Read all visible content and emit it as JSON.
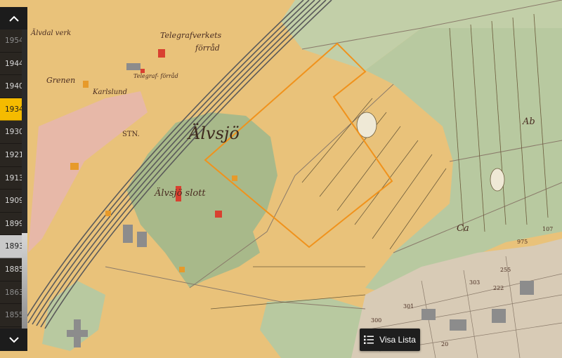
{
  "map": {
    "labels": {
      "area_main": "Älvsjö",
      "slott": "Älvsjö slott",
      "telegraf_top": "Telegrafverkets",
      "telegraf_bottom": "förråd",
      "telegraf_small": "Telegraf- förråd",
      "karlslund": "Karlslund",
      "alvdal": "Älvdal verk",
      "gren": "Grenen",
      "stn": "STN.",
      "ab": "Ab",
      "ca": "Ca",
      "numbers": [
        "303",
        "301",
        "300",
        "255",
        "107",
        "975",
        "222",
        "20"
      ]
    },
    "colors": {
      "field": "#e9c27a",
      "meadow": "#b8c9a0",
      "forest": "#a8b98a",
      "selection": "#f0921c",
      "rail": "#5a5a5a"
    }
  },
  "timeline": {
    "up_icon": "chevron-up-icon",
    "down_icon": "chevron-down-icon",
    "selected_year": "1934",
    "years": [
      {
        "label": "1954",
        "state": "dim"
      },
      {
        "label": "1944",
        "state": "normal"
      },
      {
        "label": "1940",
        "state": "normal"
      },
      {
        "label": "1934",
        "state": "active"
      },
      {
        "label": "1930",
        "state": "normal"
      },
      {
        "label": "1921",
        "state": "normal"
      },
      {
        "label": "1913",
        "state": "normal"
      },
      {
        "label": "1909",
        "state": "normal"
      },
      {
        "label": "1899",
        "state": "normal"
      },
      {
        "label": "1893",
        "state": "light"
      },
      {
        "label": "1885",
        "state": "normal"
      },
      {
        "label": "1863",
        "state": "dim"
      },
      {
        "label": "1855",
        "state": "dim"
      }
    ]
  },
  "list_button": {
    "label": "Visa Lista",
    "icon": "list-icon"
  }
}
